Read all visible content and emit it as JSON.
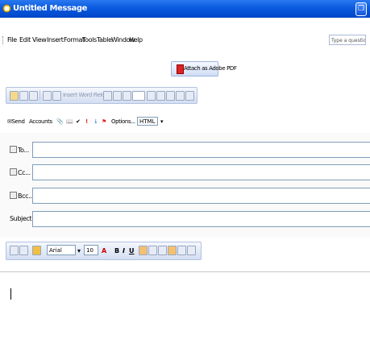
{
  "window": {
    "title": "Untitled Message"
  },
  "menubar": {
    "items": [
      "File",
      "Edit",
      "View",
      "Insert",
      "Format",
      "Tools",
      "Table",
      "Window",
      "Help"
    ],
    "ask_placeholder": "Type a question for help"
  },
  "pdf_toolbar": {
    "label": "Attach as Adobe PDF"
  },
  "standard_toolbar": {
    "insert_label": "Insert Word Field"
  },
  "send_toolbar": {
    "send": "Send",
    "accounts": "Accounts",
    "options": "Options...",
    "format": "HTML"
  },
  "headers": {
    "to": "To...",
    "cc": "Cc...",
    "bcc": "Bcc...",
    "subject": "Subject:"
  },
  "format_toolbar": {
    "font": "Arial",
    "size": "10",
    "bold": "B",
    "italic": "I",
    "underline": "U"
  },
  "colors": {
    "accent": "#0a5ae0",
    "pdf_red": "#d22222"
  }
}
